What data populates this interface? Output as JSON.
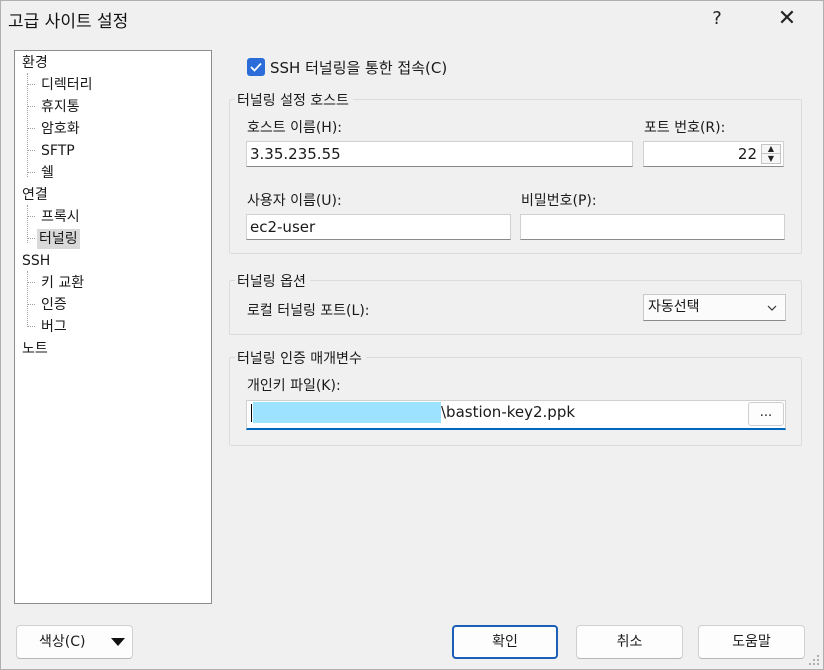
{
  "window": {
    "title": "고급 사이트 설정",
    "help_label": "?",
    "close_label": "✕"
  },
  "tree": {
    "items": [
      {
        "label": "환경"
      },
      {
        "label": "디렉터리"
      },
      {
        "label": "휴지통"
      },
      {
        "label": "암호화"
      },
      {
        "label": "SFTP"
      },
      {
        "label": "쉘"
      },
      {
        "label": "연결"
      },
      {
        "label": "프록시"
      },
      {
        "label": "터널링",
        "selected": true
      },
      {
        "label": "SSH"
      },
      {
        "label": "키 교환"
      },
      {
        "label": "인증"
      },
      {
        "label": "버그"
      },
      {
        "label": "노트"
      }
    ]
  },
  "tunnel": {
    "checkbox_label": "SSH 터널링을 통한 접속(C)",
    "checked": true,
    "host_group": {
      "title": "터널링 설정 호스트",
      "hostname_label": "호스트 이름(H):",
      "hostname_value": "3.35.235.55",
      "port_label": "포트 번호(R):",
      "port_value": "22",
      "username_label": "사용자 이름(U):",
      "username_value": "ec2-user",
      "password_label": "비밀번호(P):",
      "password_value": ""
    },
    "options_group": {
      "title": "터널링 옵션",
      "local_port_label": "로컬 터널링 포트(L):",
      "local_port_value": "자동선택"
    },
    "auth_group": {
      "title": "터널링 인증 매개변수",
      "keyfile_label": "개인키 파일(K):",
      "keyfile_value": "\\bastion-key2.ppk",
      "browse_label": "..."
    }
  },
  "buttons": {
    "color": "색상(C)",
    "ok": "확인",
    "cancel": "취소",
    "help": "도움말"
  },
  "colors": {
    "accent": "#0067c0",
    "checkbox": "#2b6cd9",
    "redaction": "#9de2ff"
  }
}
